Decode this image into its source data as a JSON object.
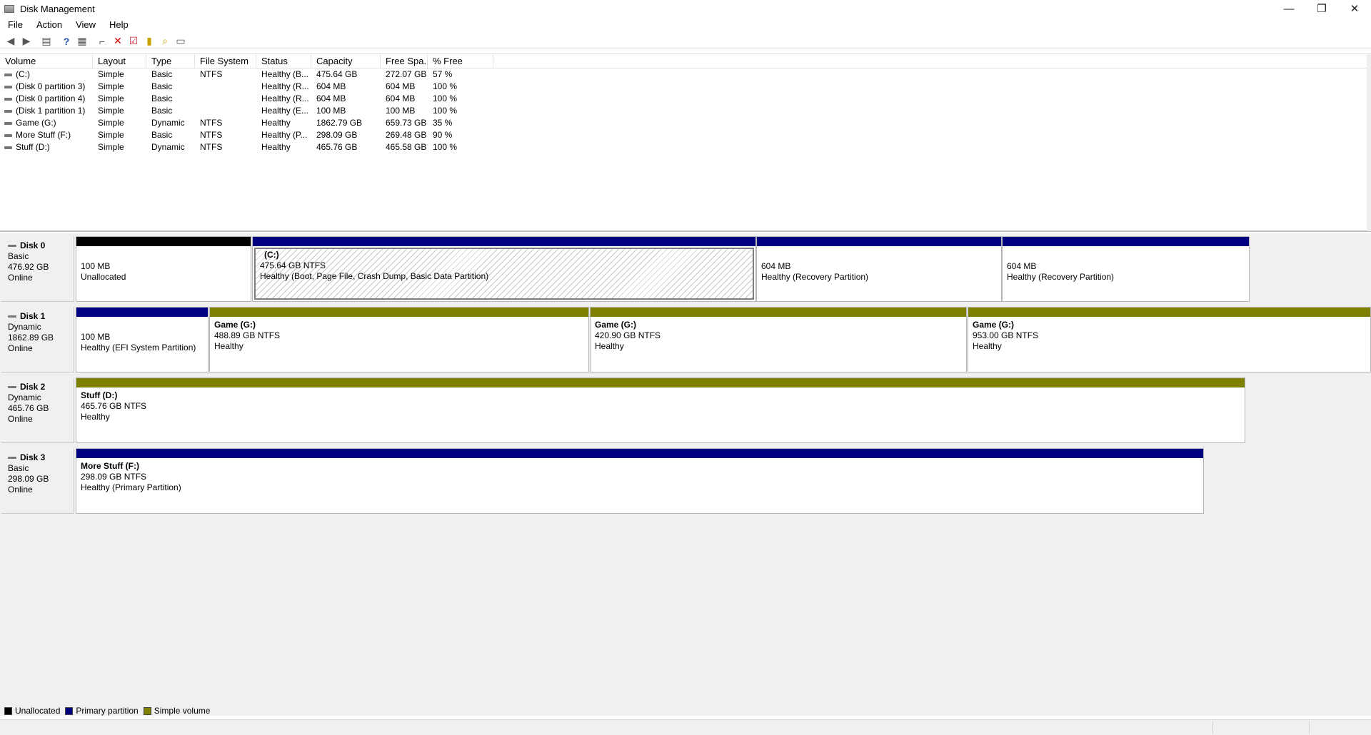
{
  "window": {
    "title": "Disk Management",
    "controls": {
      "minimize": "—",
      "restore": "❐",
      "close": "✕"
    }
  },
  "menu": [
    "File",
    "Action",
    "View",
    "Help"
  ],
  "toolbar": [
    "back-icon",
    "forward-icon",
    "properties-icon",
    "help-icon",
    "console-icon",
    "connect-icon",
    "delete-icon",
    "check-icon",
    "refresh-icon",
    "search-icon",
    "settings-icon"
  ],
  "columns": [
    "Volume",
    "Layout",
    "Type",
    "File System",
    "Status",
    "Capacity",
    "Free Spa...",
    "% Free"
  ],
  "volumes": [
    [
      "(C:)",
      "Simple",
      "Basic",
      "NTFS",
      "Healthy (B...",
      "475.64 GB",
      "272.07 GB",
      "57 %"
    ],
    [
      "(Disk 0 partition 3)",
      "Simple",
      "Basic",
      "",
      "Healthy (R...",
      "604 MB",
      "604 MB",
      "100 %"
    ],
    [
      "(Disk 0 partition 4)",
      "Simple",
      "Basic",
      "",
      "Healthy (R...",
      "604 MB",
      "604 MB",
      "100 %"
    ],
    [
      "(Disk 1 partition 1)",
      "Simple",
      "Basic",
      "",
      "Healthy (E...",
      "100 MB",
      "100 MB",
      "100 %"
    ],
    [
      "Game (G:)",
      "Simple",
      "Dynamic",
      "NTFS",
      "Healthy",
      "1862.79 GB",
      "659.73 GB",
      "35 %"
    ],
    [
      "More Stuff (F:)",
      "Simple",
      "Basic",
      "NTFS",
      "Healthy (P...",
      "298.09 GB",
      "269.48 GB",
      "90 %"
    ],
    [
      "Stuff (D:)",
      "Simple",
      "Dynamic",
      "NTFS",
      "Healthy",
      "465.76 GB",
      "465.58 GB",
      "100 %"
    ]
  ],
  "disks": [
    {
      "name": "Disk 0",
      "type": "Basic",
      "size": "476.92 GB",
      "state": "Online",
      "partitions": [
        {
          "name": "",
          "line1": "100 MB",
          "line2": "Unallocated",
          "color": "#000000"
        },
        {
          "name": "(C:)",
          "line1": "475.64 GB NTFS",
          "line2": "Healthy (Boot, Page File, Crash Dump, Basic Data Partition)",
          "color": "#000080"
        },
        {
          "name": "",
          "line1": "604 MB",
          "line2": "Healthy (Recovery Partition)",
          "color": "#000080"
        },
        {
          "name": "",
          "line1": "604 MB",
          "line2": "Healthy (Recovery Partition)",
          "color": "#000080"
        }
      ]
    },
    {
      "name": "Disk 1",
      "type": "Dynamic",
      "size": "1862.89 GB",
      "state": "Online",
      "partitions": [
        {
          "name": "",
          "line1": "100 MB",
          "line2": "Healthy (EFI System Partition)",
          "color": "#000080"
        },
        {
          "name": "Game  (G:)",
          "line1": "488.89 GB NTFS",
          "line2": "Healthy",
          "color": "#808000"
        },
        {
          "name": "Game  (G:)",
          "line1": "420.90 GB NTFS",
          "line2": "Healthy",
          "color": "#808000"
        },
        {
          "name": "Game  (G:)",
          "line1": "953.00 GB NTFS",
          "line2": "Healthy",
          "color": "#808000"
        }
      ]
    },
    {
      "name": "Disk 2",
      "type": "Dynamic",
      "size": "465.76 GB",
      "state": "Online",
      "partitions": [
        {
          "name": "Stuff  (D:)",
          "line1": "465.76 GB NTFS",
          "line2": "Healthy",
          "color": "#808000"
        }
      ]
    },
    {
      "name": "Disk 3",
      "type": "Basic",
      "size": "298.09 GB",
      "state": "Online",
      "partitions": [
        {
          "name": "More Stuff  (F:)",
          "line1": "298.09 GB NTFS",
          "line2": "Healthy (Primary Partition)",
          "color": "#000080"
        }
      ]
    }
  ],
  "legend": [
    {
      "label": "Unallocated",
      "color": "#000000"
    },
    {
      "label": "Primary partition",
      "color": "#000080"
    },
    {
      "label": "Simple volume",
      "color": "#808000"
    }
  ]
}
